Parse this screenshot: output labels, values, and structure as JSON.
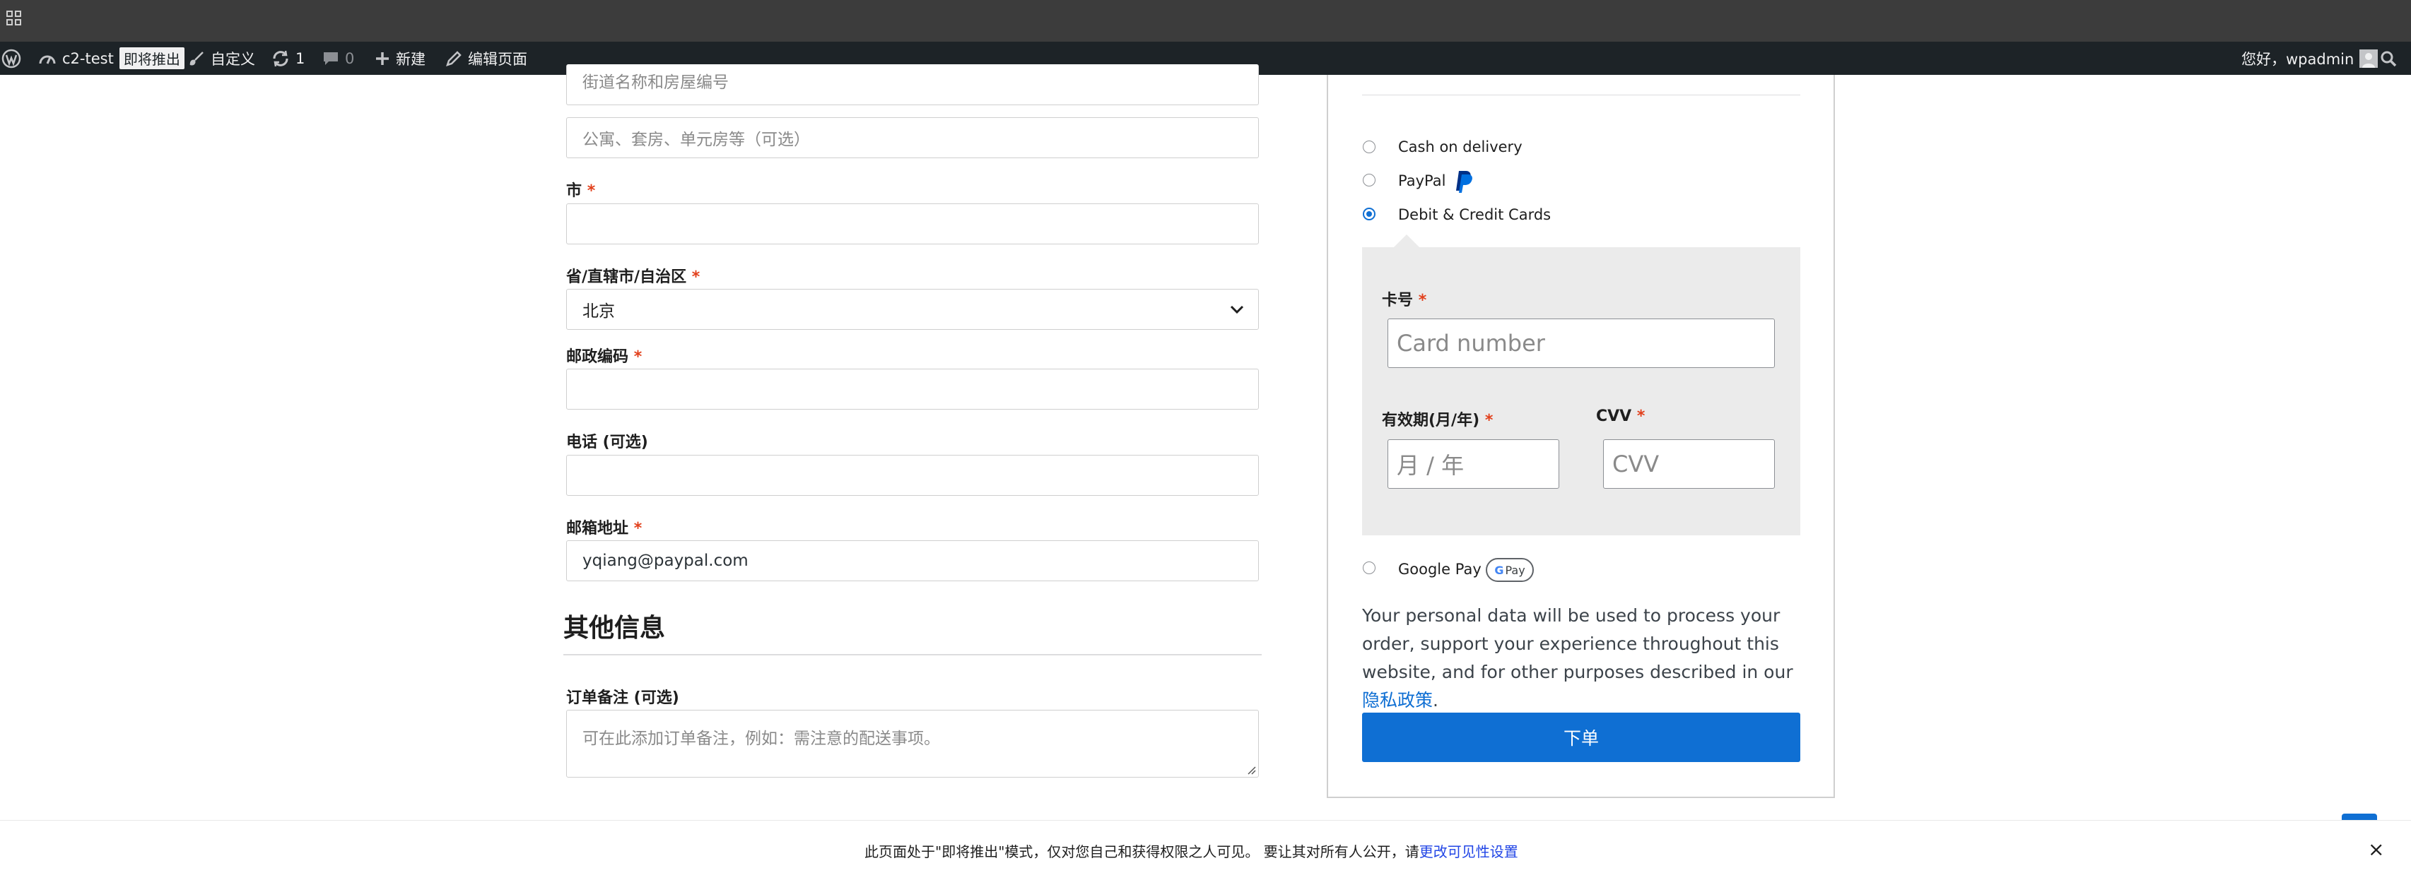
{
  "adminbar": {
    "site_name": "c2-test",
    "coming_soon_badge": "即将推出",
    "customize": "自定义",
    "updates_count": "1",
    "comments_count": "0",
    "new": "新建",
    "edit_page": "编辑页面",
    "greeting": "您好，wpadmin"
  },
  "form": {
    "street_placeholder": "街道名称和房屋编号",
    "apartment_placeholder": "公寓、套房、单元房等（可选）",
    "city_label": "市",
    "state_label": "省/直辖市/自治区",
    "state_value": "北京",
    "postcode_label": "邮政编码",
    "phone_label": "电话 (可选)",
    "email_label": "邮箱地址",
    "email_value": "yqiang@paypal.com",
    "required_mark": "*",
    "other_info_heading": "其他信息",
    "notes_label": "订单备注 (可选)",
    "notes_placeholder": "可在此添加订单备注，例如：需注意的配送事项。"
  },
  "payment": {
    "methods": [
      {
        "label": "Cash on delivery",
        "selected": false
      },
      {
        "label": "PayPal",
        "selected": false
      },
      {
        "label": "Debit & Credit Cards",
        "selected": true
      },
      {
        "label": "Google Pay",
        "selected": false
      }
    ],
    "card_number_label": "卡号",
    "card_number_placeholder": "Card number",
    "expiry_label": "有效期(月/年)",
    "expiry_placeholder": "月 / 年",
    "cvv_label": "CVV",
    "cvv_placeholder": "CVV",
    "gpay_badge": "Pay",
    "privacy_text": "Your personal data will be used to process your order, support your experience throughout this website, and for other purposes described in our",
    "privacy_link": "隐私政策",
    "place_order": "下单"
  },
  "notice": {
    "text": "此页面处于\"即将推出\"模式，仅对您自己和获得权限之人可见。 要让其对所有人公开，请",
    "link": "更改可见性设置",
    "close": "×"
  },
  "colors": {
    "primary": "#0f6fd3",
    "required": "#e2401c",
    "adminbar": "#1d2327"
  }
}
